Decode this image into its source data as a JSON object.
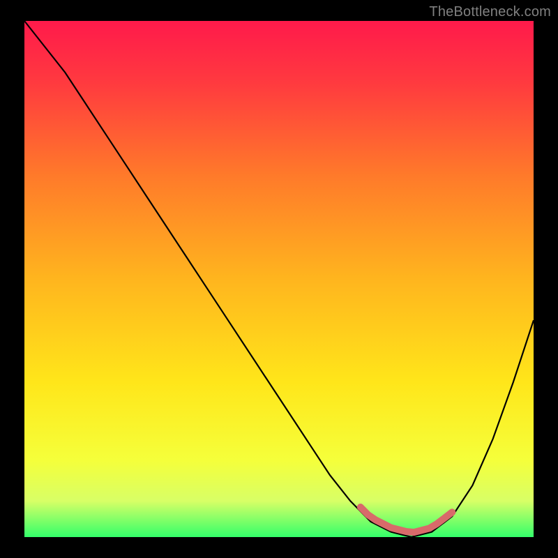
{
  "attribution": "TheBottleneck.com",
  "colors": {
    "gradient_top": "#ff1a4b",
    "gradient_bottom": "#33ff6a",
    "curve": "#000000",
    "optimal_highlight": "#d86a6a",
    "page_background": "#000000"
  },
  "chart_data": {
    "type": "line",
    "title": "",
    "xlabel": "",
    "ylabel": "",
    "xlim": [
      0,
      100
    ],
    "ylim": [
      0,
      100
    ],
    "x": [
      0,
      4,
      8,
      12,
      16,
      20,
      24,
      28,
      32,
      36,
      40,
      44,
      48,
      52,
      56,
      60,
      64,
      68,
      72,
      76,
      80,
      84,
      88,
      92,
      96,
      100
    ],
    "series": [
      {
        "name": "bottleneck_percent",
        "values": [
          100,
          95,
          90,
          84,
          78,
          72,
          66,
          60,
          54,
          48,
          42,
          36,
          30,
          24,
          18,
          12,
          7,
          3,
          1,
          0,
          1,
          4,
          10,
          19,
          30,
          42
        ]
      }
    ],
    "optimal_range": {
      "x_start": 66,
      "x_end": 84
    },
    "optimal_end_marker_x": 84
  }
}
